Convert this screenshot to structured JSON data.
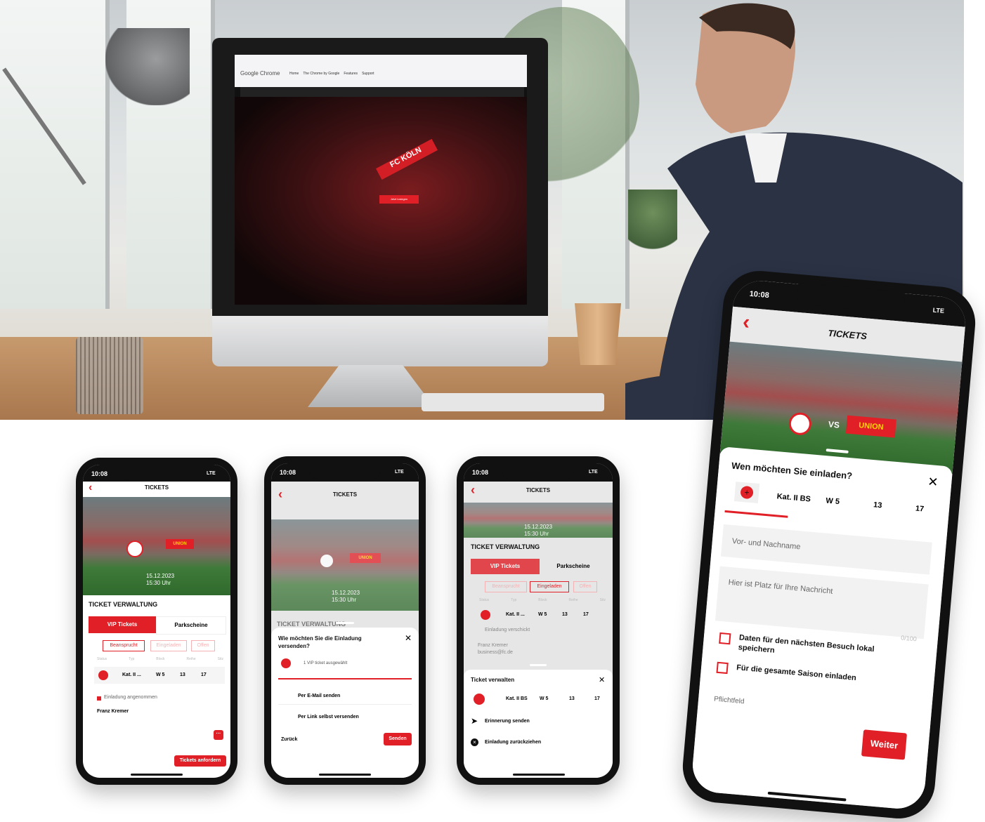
{
  "desktop": {
    "browser_brand": "Google Chrome",
    "nav": [
      "Home",
      "The Chrome by Google",
      "Features",
      "Support"
    ],
    "hero_button": "Jetzt loslegen",
    "scarf_text": "FC KÖLN"
  },
  "colors": {
    "accent": "#e11f26",
    "dark": "#111111",
    "field_bg": "#f2f2f2"
  },
  "phone1": {
    "time": "10:08",
    "network": "LTE",
    "header": "TICKETS",
    "back_icon": "chevron-left-icon",
    "section_title": "TICKET VERWALTUNG",
    "tabs": [
      "VIP Tickets",
      "Parkscheine"
    ],
    "filters": [
      "Beansprucht",
      "Eingeladen",
      "Offen"
    ],
    "columns": [
      "Status",
      "Typ",
      "Block",
      "Reihe",
      "Sitz"
    ],
    "row": {
      "type": "Kat. II ...",
      "block": "W 5",
      "row": "13",
      "seat": "17"
    },
    "status_text": "Einladung angenommen",
    "person": "Franz Kremer",
    "more": "···",
    "cta": "Tickets anfordern",
    "date": "15.12.2023",
    "time_label": "15:30 Uhr"
  },
  "phone2": {
    "time": "10:08",
    "network": "LTE",
    "header": "TICKETS",
    "background_title": "TICKET VERWALTUNG",
    "sheet_title": "Wie möchten Sie die Einladung versenden?",
    "selected": "1 VIP ticket ausgewählt",
    "option_email": "Per E-Mail senden",
    "option_link": "Per Link selbst versenden",
    "back": "Zurück",
    "send": "Senden",
    "date": "15.12.2023",
    "time_label": "15:30 Uhr"
  },
  "phone3": {
    "time": "10:08",
    "network": "LTE",
    "header": "TICKETS",
    "section_title": "TICKET VERWALTUNG",
    "tabs": [
      "VIP Tickets",
      "Parkscheine"
    ],
    "filters": [
      "Beansprucht",
      "Eingeladen",
      "Offen"
    ],
    "columns": [
      "Status",
      "Typ",
      "Block",
      "Reihe",
      "Sitz"
    ],
    "row": {
      "type": "Kat. II ...",
      "block": "W 5",
      "row": "13",
      "seat": "17"
    },
    "status_text": "Einladung verschickt",
    "person": "Franz Kremer",
    "email": "business@fc.de",
    "sheet_title": "Ticket verwalten",
    "sheet_row": {
      "type": "Kat. II BS",
      "block": "W 5",
      "row": "13",
      "seat": "17"
    },
    "action_reminder": "Erinnerung senden",
    "action_withdraw": "Einladung zurückziehen",
    "date": "15.12.2023",
    "time_label": "15:30 Uhr"
  },
  "phone4": {
    "time": "10:08",
    "network": "LTE",
    "header": "TICKETS",
    "vs": "VS",
    "opponent": "UNION",
    "sheet_title": "Wen möchten Sie einladen?",
    "ticket": {
      "type": "Kat. II BS",
      "block": "W 5",
      "row": "13",
      "seat": "17"
    },
    "name_placeholder": "Vor- und Nachname",
    "message_placeholder": "Hier ist Platz für Ihre Nachricht",
    "counter": "0/100",
    "checkbox_save": "Daten für den nächsten Besuch lokal speichern",
    "checkbox_season": "Für die gesamte Saison einladen",
    "required": "Pflichtfeld",
    "next": "Weiter"
  }
}
